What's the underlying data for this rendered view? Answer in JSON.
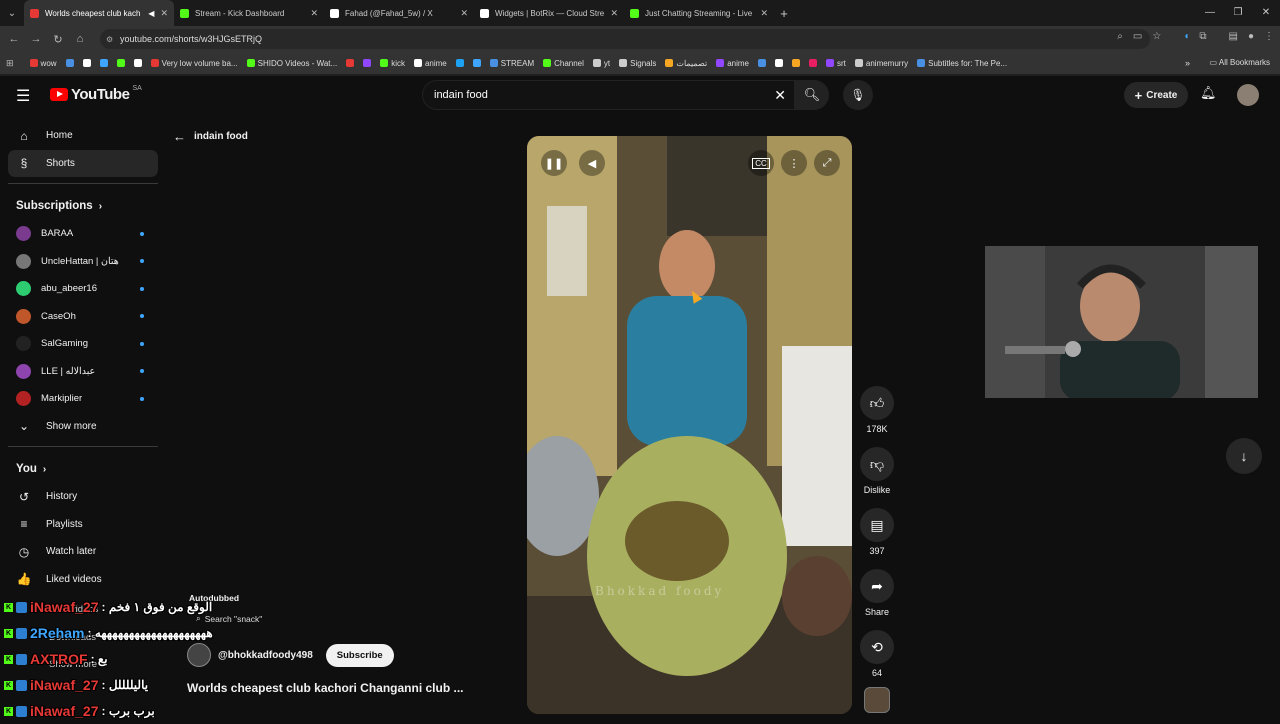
{
  "tabs": [
    {
      "title": "Worlds cheapest club kach",
      "color": "#e53935",
      "active": true
    },
    {
      "title": "Stream - Kick Dashboard",
      "color": "#53fc18",
      "active": false
    },
    {
      "title": "Fahad (@Fahad_5w) / X",
      "color": "#ffffff",
      "active": false
    },
    {
      "title": "Widgets | BotRix — Cloud Strea",
      "color": "#ffffff",
      "active": false
    },
    {
      "title": "Just Chatting Streaming - Live",
      "color": "#53fc18",
      "active": false
    }
  ],
  "url": "youtube.com/shorts/w3HJGsETRjQ",
  "bookmarks": [
    {
      "label": "wow",
      "color": "#e53935"
    },
    {
      "label": "",
      "color": "#4a90e2"
    },
    {
      "label": "",
      "color": "#ffffff"
    },
    {
      "label": "",
      "color": "#3ea6ff"
    },
    {
      "label": "",
      "color": "#53fc18"
    },
    {
      "label": "",
      "color": "#ffffff"
    },
    {
      "label": "Very low volume ba...",
      "color": "#e53935"
    },
    {
      "label": "SHIDO Videos - Wat...",
      "color": "#53fc18"
    },
    {
      "label": "",
      "color": "#e53935"
    },
    {
      "label": "",
      "color": "#9146ff"
    },
    {
      "label": "kick",
      "color": "#53fc18"
    },
    {
      "label": "anime",
      "color": "#ffffff"
    },
    {
      "label": "",
      "color": "#1da1f2"
    },
    {
      "label": "",
      "color": "#3ea6ff"
    },
    {
      "label": "STREAM",
      "color": "#4a90e2"
    },
    {
      "label": "Channel",
      "color": "#53fc18"
    },
    {
      "label": "yt",
      "color": "#cccccc"
    },
    {
      "label": "Signals",
      "color": "#cccccc"
    },
    {
      "label": "تصميمات",
      "color": "#f5a623"
    },
    {
      "label": "anime",
      "color": "#9146ff"
    },
    {
      "label": "",
      "color": "#4a90e2"
    },
    {
      "label": "",
      "color": "#ffffff"
    },
    {
      "label": "",
      "color": "#f5a623"
    },
    {
      "label": "",
      "color": "#e91e63"
    },
    {
      "label": "srt",
      "color": "#9146ff"
    },
    {
      "label": "animemurry",
      "color": "#cccccc"
    },
    {
      "label": "Subtitles for: The Pe...",
      "color": "#4a90e2"
    }
  ],
  "all_bookmarks": "All Bookmarks",
  "youtube": {
    "logo": "YouTube",
    "country": "SA",
    "search_value": "indain food",
    "create": "Create"
  },
  "sidebar": {
    "main": [
      {
        "label": "Home",
        "icon": "⌂"
      },
      {
        "label": "Shorts",
        "icon": "§"
      }
    ],
    "subscriptions_title": "Subscriptions",
    "subscriptions": [
      {
        "name": "BARAA",
        "color": "#7a3b8f"
      },
      {
        "name": "UncleHattan | هتان",
        "color": "#777777"
      },
      {
        "name": "abu_abeer16",
        "color": "#2ecc71"
      },
      {
        "name": "CaseOh",
        "color": "#c0572b"
      },
      {
        "name": "SalGaming",
        "color": "#222222"
      },
      {
        "name": "LLE | عبدالاله",
        "color": "#8e44ad"
      },
      {
        "name": "Markiplier",
        "color": "#b22222"
      }
    ],
    "show_more": "Show more",
    "you_title": "You",
    "you": [
      {
        "label": "History",
        "icon": "↺"
      },
      {
        "label": "Playlists",
        "icon": "≡"
      },
      {
        "label": "Watch later",
        "icon": "◷"
      },
      {
        "label": "Liked videos",
        "icon": "👍"
      }
    ],
    "under_overlay": [
      "Your videos",
      "Downloads",
      "Show more"
    ]
  },
  "shorts": {
    "back_label": "indain food",
    "watermark": "Bhokkad foody",
    "likes": "178K",
    "dislike": "Dislike",
    "comments": "397",
    "share": "Share",
    "remix": "64",
    "channel": "@bhokkadfoody498",
    "subscribe": "Subscribe",
    "title": "Worlds cheapest club kachori Changanni club ...",
    "autodubbed": "Autodubbed",
    "search_hint": "Search \"snack\""
  },
  "chat": [
    {
      "user": "iNawaf_27",
      "user_color": "#e53935",
      "msg": ": الوقع من فوق ١ فخم"
    },
    {
      "user": "2Reham",
      "user_color": "#3ea6ff",
      "msg": ": ههههههههههههههههههههه"
    },
    {
      "user": "AXTROF",
      "user_color": "#e53935",
      "msg": ": بع"
    },
    {
      "user": "iNawaf_27",
      "user_color": "#e53935",
      "msg": ": ياليللللل"
    },
    {
      "user": "iNawaf_27",
      "user_color": "#e53935",
      "msg": ": برب برب"
    }
  ]
}
